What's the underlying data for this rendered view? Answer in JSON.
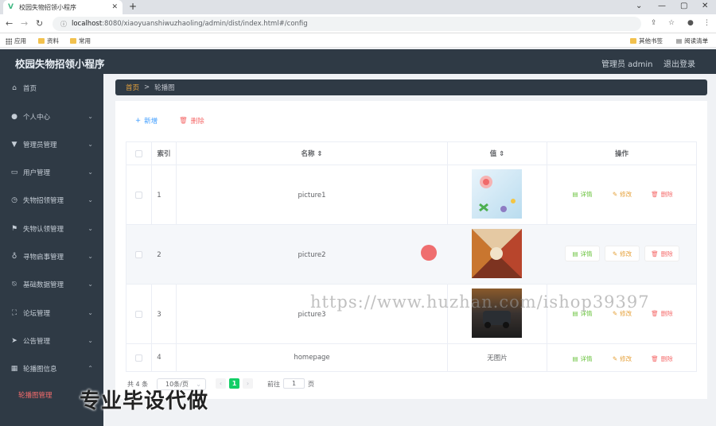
{
  "browser": {
    "tab_title": "校园失物招领小程序",
    "tab_close": "✕",
    "new_tab": "+",
    "url_host": "localhost",
    "url_rest": ":8080/xiaoyuanshiwuzhaoling/admin/dist/index.html#/config",
    "bookmarks": [
      "应用",
      "资料",
      "常用"
    ],
    "bookmarks_right": [
      "其他书签",
      "阅读清单"
    ]
  },
  "header": {
    "brand": "校园失物招领小程序",
    "user": "管理员 admin",
    "logout": "退出登录"
  },
  "sidebar": {
    "items": [
      {
        "label": "首页",
        "icon": "home-icon",
        "chev": ""
      },
      {
        "label": "个人中心",
        "icon": "user-icon",
        "chev": "⌄"
      },
      {
        "label": "管理员管理",
        "icon": "admin-icon",
        "chev": "⌄"
      },
      {
        "label": "用户管理",
        "icon": "users-icon",
        "chev": "⌄"
      },
      {
        "label": "失物招领管理",
        "icon": "clock-icon",
        "chev": "⌄"
      },
      {
        "label": "失物认领管理",
        "icon": "flag-icon",
        "chev": "⌄"
      },
      {
        "label": "寻物启事管理",
        "icon": "mic-icon",
        "chev": "⌄"
      },
      {
        "label": "基础数据管理",
        "icon": "bell-off-icon",
        "chev": "⌄"
      },
      {
        "label": "论坛管理",
        "icon": "frame-icon",
        "chev": "⌄"
      },
      {
        "label": "公告管理",
        "icon": "send-icon",
        "chev": "⌄"
      },
      {
        "label": "轮播图信息",
        "icon": "shop-icon",
        "chev": "⌃"
      }
    ],
    "sub_item": "轮播图管理"
  },
  "breadcrumb": {
    "home": "首页",
    "sep": ">",
    "current": "轮播图"
  },
  "toolbar": {
    "add": "新增",
    "delete": "删除"
  },
  "table": {
    "headers": [
      "索引",
      "名称 ⇕",
      "值 ⇕",
      "操作"
    ],
    "rows": [
      {
        "index": "1",
        "name": "picture1",
        "value": ""
      },
      {
        "index": "2",
        "name": "picture2",
        "value": ""
      },
      {
        "index": "3",
        "name": "picture3",
        "value": ""
      },
      {
        "index": "4",
        "name": "homepage",
        "value": "无图片"
      }
    ],
    "actions": {
      "detail": "详情",
      "edit": "修改",
      "remove": "删除"
    }
  },
  "pagination": {
    "total": "共 4 条",
    "page_size": "10条/页",
    "prev": "‹",
    "current_page": "1",
    "next": "›",
    "goto": "前往",
    "goto_value": "1",
    "page_suffix": "页"
  },
  "overlay": {
    "watermark": "https://www.huzhan.com/ishop39397",
    "banner": "专业毕设代做"
  }
}
